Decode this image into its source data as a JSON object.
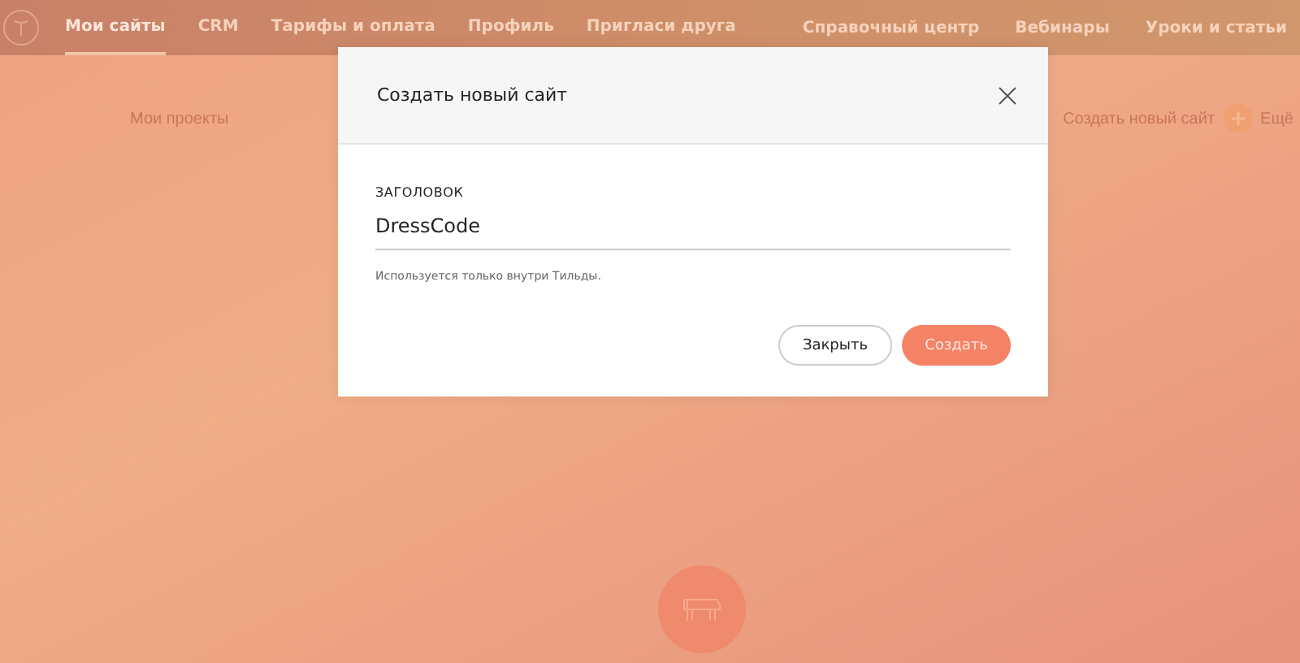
{
  "nav": {
    "left": [
      {
        "label": "Мои сайты",
        "selected": true
      },
      {
        "label": "CRM",
        "selected": false
      },
      {
        "label": "Тарифы и оплата",
        "selected": false
      },
      {
        "label": "Профиль",
        "selected": false
      },
      {
        "label": "Пригласи друга",
        "selected": false
      }
    ],
    "right": [
      "Справочный центр",
      "Вебинары",
      "Уроки и статьи"
    ]
  },
  "page": {
    "title": "Мои проекты",
    "create_label": "Создать новый сайт",
    "more_label": "Ещё"
  },
  "modal": {
    "title": "Создать новый сайт",
    "field_label": "ЗАГОЛОВОК",
    "field_value": "DressCode",
    "hint": "Используется только внутри Тильды.",
    "buttons": [
      {
        "label": "Закрыть",
        "kind": "secondary"
      },
      {
        "label": "Создать",
        "kind": "primary"
      }
    ]
  }
}
